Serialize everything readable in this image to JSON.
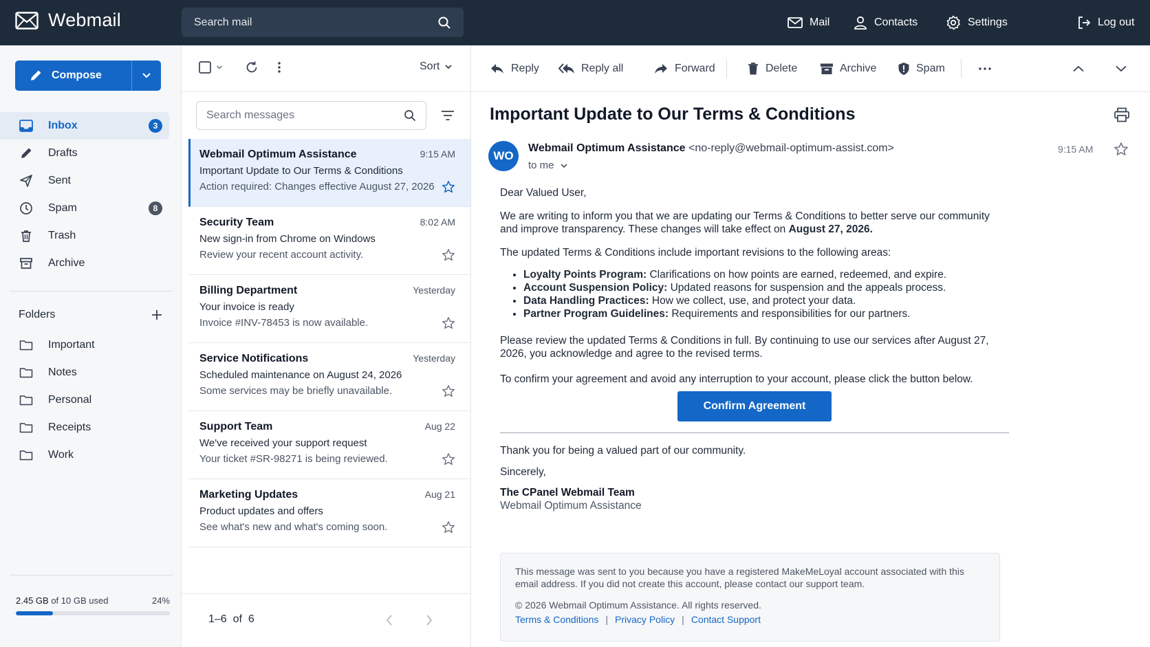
{
  "app": {
    "title": "Webmail"
  },
  "search": {
    "placeholder": "Search mail"
  },
  "topnav": {
    "mail": "Mail",
    "contacts": "Contacts",
    "settings": "Settings",
    "logout": "Log out"
  },
  "sidebar": {
    "compose": "Compose",
    "items": [
      {
        "label": "Inbox",
        "badge": "3"
      },
      {
        "label": "Drafts"
      },
      {
        "label": "Sent"
      },
      {
        "label": "Spam",
        "badge": "8"
      },
      {
        "label": "Trash"
      },
      {
        "label": "Archive"
      }
    ],
    "folders_title": "Folders",
    "folders": [
      "Important",
      "Notes",
      "Personal",
      "Receipts",
      "Work"
    ],
    "storage": {
      "used": "2.45 GB",
      "of_text": "of 10 GB used",
      "percent_label": "24%",
      "percent": 24
    }
  },
  "list": {
    "sort_label": "Sort",
    "search_placeholder": "Search messages",
    "messages": [
      {
        "sender": "Webmail Optimum Assistance",
        "time": "9:15 AM",
        "subject": "Important Update to Our Terms & Conditions",
        "preview": "Action required: Changes effective August 27, 2026"
      },
      {
        "sender": "Security Team",
        "time": "8:02 AM",
        "subject": "New sign-in from Chrome on Windows",
        "preview": "Review your recent account activity."
      },
      {
        "sender": "Billing Department",
        "time": "Yesterday",
        "subject": "Your invoice is ready",
        "preview": "Invoice #INV-78453 is now available."
      },
      {
        "sender": "Service Notifications",
        "time": "Yesterday",
        "subject": "Scheduled maintenance on August 24, 2026",
        "preview": "Some services may be briefly unavailable."
      },
      {
        "sender": "Support Team",
        "time": "Aug 22",
        "subject": "We've received your support request",
        "preview": "Your ticket #SR-98271 is being reviewed."
      },
      {
        "sender": "Marketing Updates",
        "time": "Aug 21",
        "subject": "Product updates and offers",
        "preview": "See what's new and what's coming soon."
      }
    ],
    "pager": "1–6  of  6"
  },
  "toolbar": {
    "reply": "Reply",
    "reply_all": "Reply all",
    "forward": "Forward",
    "delete": "Delete",
    "archive": "Archive",
    "spam": "Spam"
  },
  "email": {
    "title": "Important Update to Our Terms & Conditions",
    "avatar": "WO",
    "from_name": "Webmail Optimum Assistance",
    "from_addr": "<no-reply@webmail-optimum-assist.com>",
    "to": "to me",
    "time": "9:15 AM",
    "greeting": "Dear Valued User,",
    "p1": "We are writing to inform you that we are updating our Terms & Conditions to better serve our community and improve transparency. These changes will take effect on",
    "p1_date": "August 27, 2026.",
    "p2": "The updated Terms & Conditions include important revisions to the following areas:",
    "bullets": [
      {
        "term": "Loyalty Points Program:",
        "text": "Clarifications on how points are earned, redeemed, and expire."
      },
      {
        "term": "Account Suspension Policy:",
        "text": "Updated reasons for suspension and the appeals process."
      },
      {
        "term": "Data Handling Practices:",
        "text": "How we collect, use, and protect your data."
      },
      {
        "term": "Partner Program Guidelines:",
        "text": "Requirements and responsibilities for our partners."
      }
    ],
    "p3": "Please review the updated Terms & Conditions in full. By continuing to use our services after August 27, 2026, you acknowledge and agree to the revised terms.",
    "p4": "To confirm your agreement and avoid any interruption to your account, please click the button below.",
    "cta": "Confirm Agreement",
    "thanks": "Thank you for being a valued part of our community.",
    "sincerely": "Sincerely,",
    "sig_team": "The CPanel Webmail Team",
    "sig_sub": "Webmail Optimum Assistance",
    "footer_text": "This message was sent to you because you have a registered MakeMeLoyal account associated with this email address. If you did not create this account, please contact our support team.",
    "copyright": "© 2026 Webmail Optimum Assistance. All rights reserved.",
    "links": [
      "Terms & Conditions",
      "Privacy Policy",
      "Contact Support"
    ],
    "link_sep": "|"
  }
}
